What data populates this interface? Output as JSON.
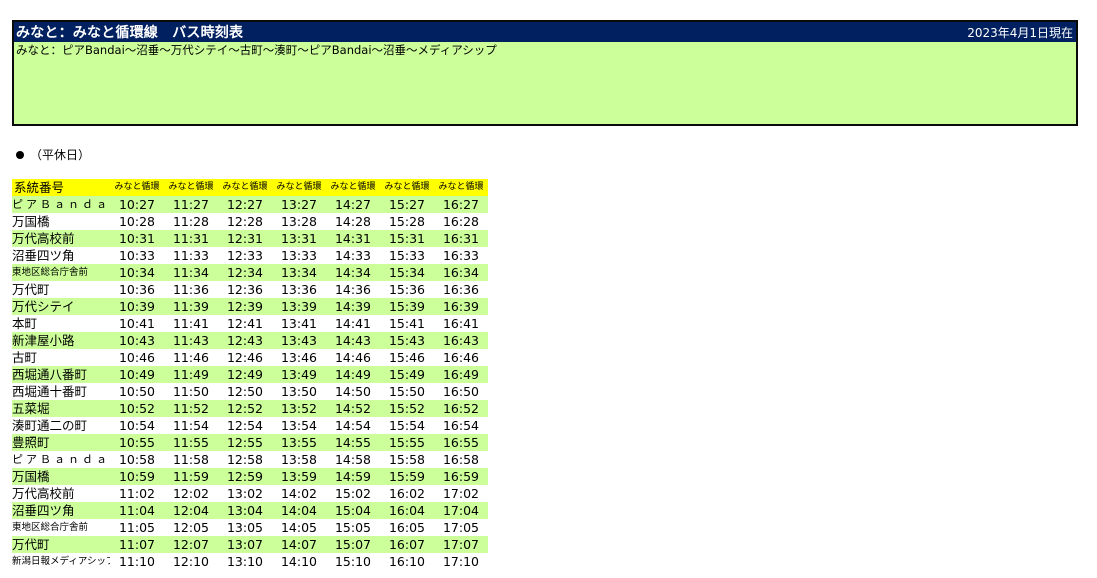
{
  "header": {
    "title": "みなと：みなと循環線　バス時刻表",
    "as_of": "2023年4月1日現在",
    "route": "みなと：ピアBandai～沼垂～万代シテイ～古町～湊町～ピアBandai～沼垂～メディアシップ"
  },
  "day_type": "（平休日）",
  "colors": {
    "title_bg": "#002060",
    "green": "#ccff99",
    "header_yellow": "#ffff00"
  },
  "table": {
    "label": "系統番号",
    "columns": [
      "みなと循環",
      "みなと循環",
      "みなと循環",
      "みなと循環",
      "みなと循環",
      "みなと循環",
      "みなと循環"
    ],
    "rows": [
      {
        "stop": "ピアＢａｎｄａｉ",
        "style": "spaced",
        "times": [
          "10:27",
          "11:27",
          "12:27",
          "13:27",
          "14:27",
          "15:27",
          "16:27"
        ]
      },
      {
        "stop": "万国橋",
        "style": "",
        "times": [
          "10:28",
          "11:28",
          "12:28",
          "13:28",
          "14:28",
          "15:28",
          "16:28"
        ]
      },
      {
        "stop": "万代高校前",
        "style": "",
        "times": [
          "10:31",
          "11:31",
          "12:31",
          "13:31",
          "14:31",
          "15:31",
          "16:31"
        ]
      },
      {
        "stop": "沼垂四ツ角",
        "style": "",
        "times": [
          "10:33",
          "11:33",
          "12:33",
          "13:33",
          "14:33",
          "15:33",
          "16:33"
        ]
      },
      {
        "stop": "東地区総合庁舎前",
        "style": "small",
        "times": [
          "10:34",
          "11:34",
          "12:34",
          "13:34",
          "14:34",
          "15:34",
          "16:34"
        ]
      },
      {
        "stop": "万代町",
        "style": "",
        "times": [
          "10:36",
          "11:36",
          "12:36",
          "13:36",
          "14:36",
          "15:36",
          "16:36"
        ]
      },
      {
        "stop": "万代シテイ",
        "style": "",
        "times": [
          "10:39",
          "11:39",
          "12:39",
          "13:39",
          "14:39",
          "15:39",
          "16:39"
        ]
      },
      {
        "stop": "本町",
        "style": "",
        "times": [
          "10:41",
          "11:41",
          "12:41",
          "13:41",
          "14:41",
          "15:41",
          "16:41"
        ]
      },
      {
        "stop": "新津屋小路",
        "style": "",
        "times": [
          "10:43",
          "11:43",
          "12:43",
          "13:43",
          "14:43",
          "15:43",
          "16:43"
        ]
      },
      {
        "stop": "古町",
        "style": "",
        "times": [
          "10:46",
          "11:46",
          "12:46",
          "13:46",
          "14:46",
          "15:46",
          "16:46"
        ]
      },
      {
        "stop": "西堀通八番町",
        "style": "",
        "times": [
          "10:49",
          "11:49",
          "12:49",
          "13:49",
          "14:49",
          "15:49",
          "16:49"
        ]
      },
      {
        "stop": "西堀通十番町",
        "style": "",
        "times": [
          "10:50",
          "11:50",
          "12:50",
          "13:50",
          "14:50",
          "15:50",
          "16:50"
        ]
      },
      {
        "stop": "五菜堀",
        "style": "",
        "times": [
          "10:52",
          "11:52",
          "12:52",
          "13:52",
          "14:52",
          "15:52",
          "16:52"
        ]
      },
      {
        "stop": "湊町通二の町",
        "style": "",
        "times": [
          "10:54",
          "11:54",
          "12:54",
          "13:54",
          "14:54",
          "15:54",
          "16:54"
        ]
      },
      {
        "stop": "豊照町",
        "style": "",
        "times": [
          "10:55",
          "11:55",
          "12:55",
          "13:55",
          "14:55",
          "15:55",
          "16:55"
        ]
      },
      {
        "stop": "ピアＢａｎｄａｉ",
        "style": "spaced",
        "times": [
          "10:58",
          "11:58",
          "12:58",
          "13:58",
          "14:58",
          "15:58",
          "16:58"
        ]
      },
      {
        "stop": "万国橋",
        "style": "",
        "times": [
          "10:59",
          "11:59",
          "12:59",
          "13:59",
          "14:59",
          "15:59",
          "16:59"
        ]
      },
      {
        "stop": "万代高校前",
        "style": "",
        "times": [
          "11:02",
          "12:02",
          "13:02",
          "14:02",
          "15:02",
          "16:02",
          "17:02"
        ]
      },
      {
        "stop": "沼垂四ツ角",
        "style": "",
        "times": [
          "11:04",
          "12:04",
          "13:04",
          "14:04",
          "15:04",
          "16:04",
          "17:04"
        ]
      },
      {
        "stop": "東地区総合庁舎前",
        "style": "small",
        "times": [
          "11:05",
          "12:05",
          "13:05",
          "14:05",
          "15:05",
          "16:05",
          "17:05"
        ]
      },
      {
        "stop": "万代町",
        "style": "",
        "times": [
          "11:07",
          "12:07",
          "13:07",
          "14:07",
          "15:07",
          "16:07",
          "17:07"
        ]
      },
      {
        "stop": "新潟日報メディアシップ",
        "style": "small",
        "times": [
          "11:10",
          "12:10",
          "13:10",
          "14:10",
          "15:10",
          "16:10",
          "17:10"
        ]
      }
    ]
  }
}
